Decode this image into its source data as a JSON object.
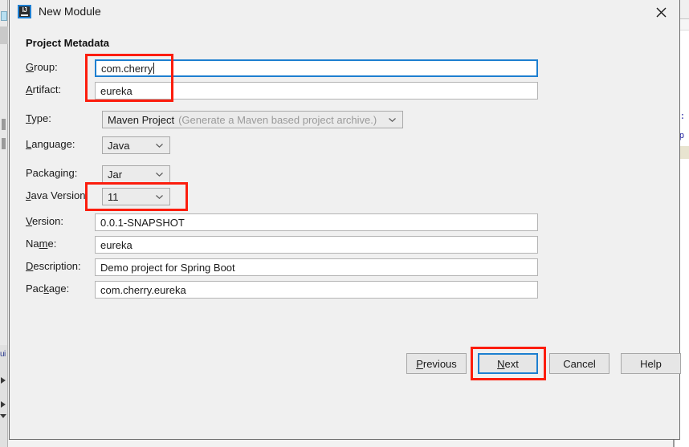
{
  "window": {
    "title": "New Module",
    "app_icon_name": "intellij-idea-icon",
    "app_icon_letters": "IJ",
    "close_icon": "close-icon"
  },
  "form": {
    "section_heading": "Project Metadata",
    "fields": [
      {
        "id": "group",
        "label_pre": "",
        "label_mnemonic": "G",
        "label_post": "roup:",
        "type": "text",
        "value": "com.cherry",
        "focused": true,
        "caret": true
      },
      {
        "id": "artifact",
        "label_pre": "",
        "label_mnemonic": "A",
        "label_post": "rtifact:",
        "type": "text",
        "value": "eureka",
        "focused": false,
        "caret": false
      },
      {
        "id": "type",
        "label_pre": "",
        "label_mnemonic": "T",
        "label_post": "ype:",
        "type": "combo",
        "value": "Maven Project",
        "hint": "(Generate a Maven based project archive.)",
        "disabled": true
      },
      {
        "id": "language",
        "label_pre": "",
        "label_mnemonic": "L",
        "label_post": "anguage:",
        "type": "combo",
        "value": "Java",
        "hint": ""
      },
      {
        "id": "packaging",
        "label_pre": "Packa",
        "label_mnemonic": "g",
        "label_post": "ing:",
        "type": "combo",
        "value": "Jar",
        "hint": ""
      },
      {
        "id": "java-version",
        "label_pre": "",
        "label_mnemonic": "J",
        "label_post": "ava Version:",
        "type": "combo",
        "value": "11",
        "hint": ""
      },
      {
        "id": "version",
        "label_pre": "",
        "label_mnemonic": "V",
        "label_post": "ersion:",
        "type": "text",
        "value": "0.0.1-SNAPSHOT",
        "focused": false,
        "caret": false
      },
      {
        "id": "name",
        "label_pre": "Na",
        "label_mnemonic": "m",
        "label_post": "e:",
        "type": "text",
        "value": "eureka",
        "focused": false,
        "caret": false
      },
      {
        "id": "description",
        "label_pre": "",
        "label_mnemonic": "D",
        "label_post": "escription:",
        "type": "text",
        "value": "Demo project for Spring Boot",
        "focused": false,
        "caret": false
      },
      {
        "id": "package",
        "label_pre": "Pac",
        "label_mnemonic": "k",
        "label_post": "age:",
        "type": "text",
        "value": "com.cherry.eureka",
        "focused": false,
        "caret": false
      }
    ]
  },
  "buttons": [
    {
      "id": "previous",
      "pre": "",
      "mnemonic": "P",
      "post": "revious",
      "focused": false
    },
    {
      "id": "next",
      "pre": "",
      "mnemonic": "N",
      "post": "ext",
      "focused": true
    },
    {
      "id": "cancel",
      "pre": "Cancel",
      "mnemonic": "",
      "post": "",
      "focused": false
    },
    {
      "id": "help",
      "pre": "Help",
      "mnemonic": "",
      "post": "",
      "focused": false
    }
  ],
  "annotations": {
    "color": "#fc1d0d",
    "boxes": [
      {
        "name": "group-artifact-highlight"
      },
      {
        "name": "java-version-highlight"
      },
      {
        "name": "next-button-highlight"
      }
    ]
  },
  "background": {
    "code_fragment_a": "d:",
    "code_fragment_b": "tp",
    "left_label": "ui"
  }
}
